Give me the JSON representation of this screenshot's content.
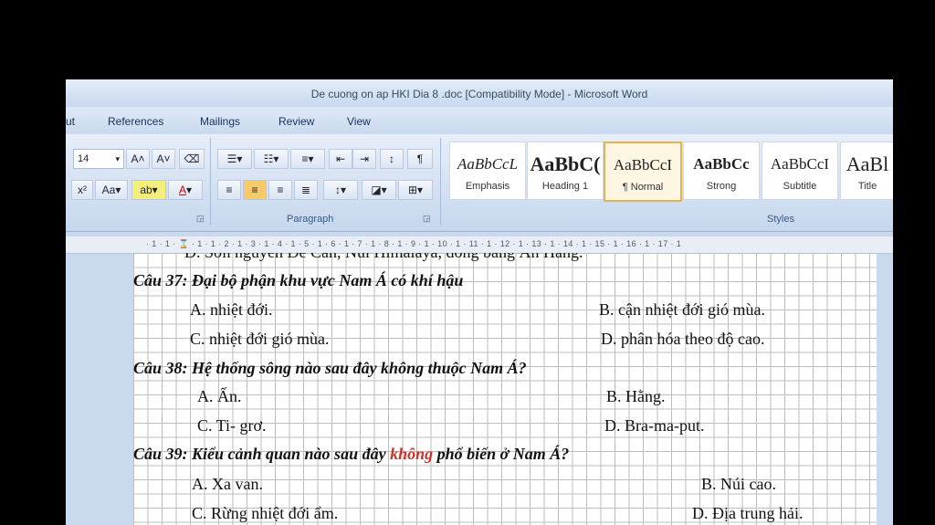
{
  "window": {
    "title": "De cuong on ap HKI  Dia 8 .doc [Compatibility Mode] - Microsoft Word"
  },
  "menu": [
    "ut",
    "References",
    "Mailings",
    "Review",
    "View"
  ],
  "font": {
    "size": "14"
  },
  "groups": {
    "paragraph": "Paragraph",
    "styles": "Styles"
  },
  "styles": [
    {
      "sample": "AaBbCcL",
      "name": "Emphasis"
    },
    {
      "sample": "AaBbC(",
      "name": "Heading 1"
    },
    {
      "sample": "AaBbCcI",
      "name": "¶ Normal"
    },
    {
      "sample": "AaBbCc",
      "name": "Strong"
    },
    {
      "sample": "AaBbCcI",
      "name": "Subtitle"
    },
    {
      "sample": "AaBl",
      "name": "Title"
    }
  ],
  "ruler": "· 1 · 1 · ⌛ · 1 · 1 · 2 · 1 · 3 · 1 · 4 · 1 · 5 · 1 · 6 · 1 · 7 · 1 · 8 · 1 · 9 · 1 · 10 · 1 · 11 · 1 · 12 · 1 · 13 · 1 · 14 · 1 · 15 · 1 · 16 · 1 · 17 · 1",
  "doc": {
    "top_cut": "D. Sơn nguyên Đê Can, Núi Himalaya, đồng bằng Ấn Hằng.",
    "q37": "Câu 37: Đại bộ phận khu vực Nam Á có khí hậu",
    "q37a": "A. nhiệt đới.",
    "q37b": "B. cận nhiệt đới gió mùa.",
    "q37c": "C. nhiệt đới gió mùa.",
    "q37d": "D. phân hóa theo độ cao.",
    "q38": "Câu 38: Hệ thống sông nào sau đây không thuộc Nam Á?",
    "q38a": "A.  Ấn.",
    "q38b": "B. Hằng.",
    "q38c": "C.  Ti- grơ.",
    "q38d": "D. Bra-ma-put.",
    "q39_pre": "Câu 39: Kiểu cảnh quan nào sau đây ",
    "q39_red": "không",
    "q39_post": " phổ  biến ở Nam Á?",
    "q39a": "A. Xa van.",
    "q39b": "B. Núi cao.",
    "q39c": "C. Rừng nhiệt đới ẩm.",
    "q39d": "D. Địa trung hải."
  }
}
